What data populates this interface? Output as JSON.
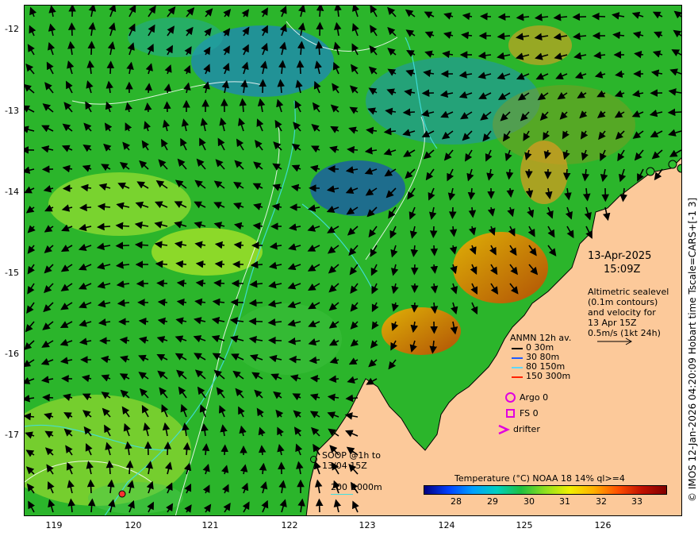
{
  "map": {
    "timestamp": {
      "date": "13-Apr-2025",
      "time": "15:09Z"
    },
    "altimetry_note": [
      "Altimetric sealevel",
      "(0.1m contours)",
      "and velocity for",
      "13 Apr 15Z",
      "0.5m/s (1kt 24h)"
    ],
    "y_axis_ticks": [
      "-12",
      "-13",
      "-14",
      "-15",
      "-16",
      "-17"
    ],
    "x_axis_ticks": [
      "119",
      "120",
      "121",
      "122",
      "123",
      "124",
      "125",
      "126"
    ],
    "anmn_legend": {
      "title": "ANMN 12h av.",
      "rows": [
        {
          "label": "0 30m",
          "color": "#000000"
        },
        {
          "label": "30 80m",
          "color": "#1f5cff"
        },
        {
          "label": "80 150m",
          "color": "#5fd7ff"
        },
        {
          "label": "150 300m",
          "color": "#ff2200"
        }
      ]
    },
    "markers": {
      "argo": "Argo 0",
      "fs": "FS 0",
      "drifter": "drifter",
      "marker_color": "#e000e0"
    },
    "soop": {
      "line1": "SOOP @1h to",
      "line2": "13/04 15Z"
    },
    "depth_contours": {
      "label_200": "200",
      "label_1000": "1000m",
      "color": "#40e0e0"
    },
    "colorbar": {
      "title": "Temperature (°C) NOAA 18 14% ql>=4",
      "ticks": [
        "28",
        "29",
        "30",
        "31",
        "32",
        "33"
      ]
    },
    "credit": "© IMOS 12-Jan-2026 04:20:09 Hobart time Tscale=CARS+[-1 3]",
    "colors": {
      "land": "#fcc99a",
      "sea_base": "#22b022",
      "arrow": "#000000"
    }
  }
}
